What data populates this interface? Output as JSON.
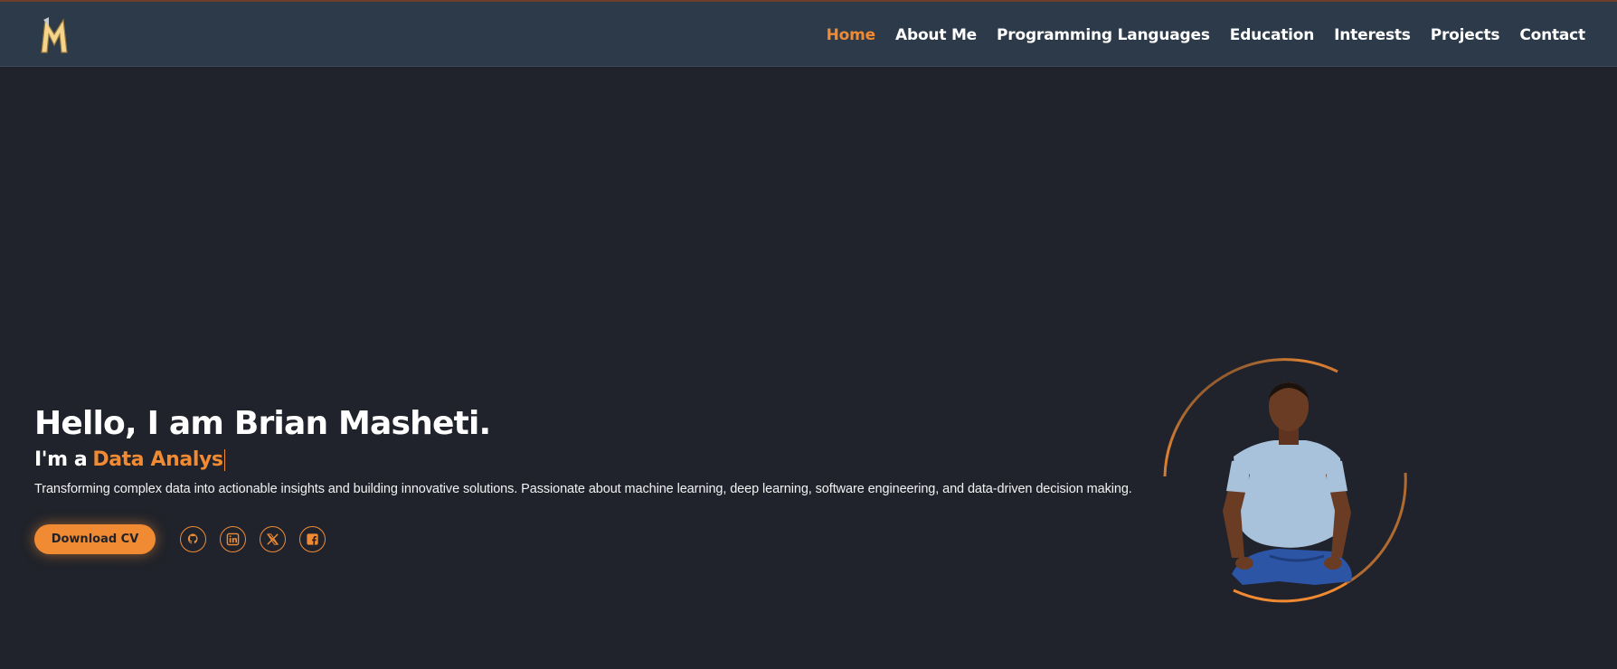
{
  "header": {
    "logo_letter": "M",
    "nav": [
      {
        "label": "Home",
        "active": true
      },
      {
        "label": "About Me",
        "active": false
      },
      {
        "label": "Programming Languages",
        "active": false
      },
      {
        "label": "Education",
        "active": false
      },
      {
        "label": "Interests",
        "active": false
      },
      {
        "label": "Projects",
        "active": false
      },
      {
        "label": "Contact",
        "active": false
      }
    ]
  },
  "hero": {
    "greeting": "Hello, I am Brian Masheti.",
    "role_prefix": "I'm a",
    "role_typed": "Data Analys",
    "tagline": "Transforming complex data into actionable insights and building innovative solutions. Passionate about machine learning, deep learning, software engineering, and data-driven decision making.",
    "cv_button": "Download CV",
    "socials": [
      {
        "icon": "github-icon",
        "label": "GitHub"
      },
      {
        "icon": "linkedin-icon"
      },
      {
        "icon": "x-twitter-icon"
      },
      {
        "icon": "facebook-icon"
      }
    ]
  },
  "colors": {
    "accent": "#f08a33",
    "background": "#20232b",
    "header": "#2c3a49"
  }
}
